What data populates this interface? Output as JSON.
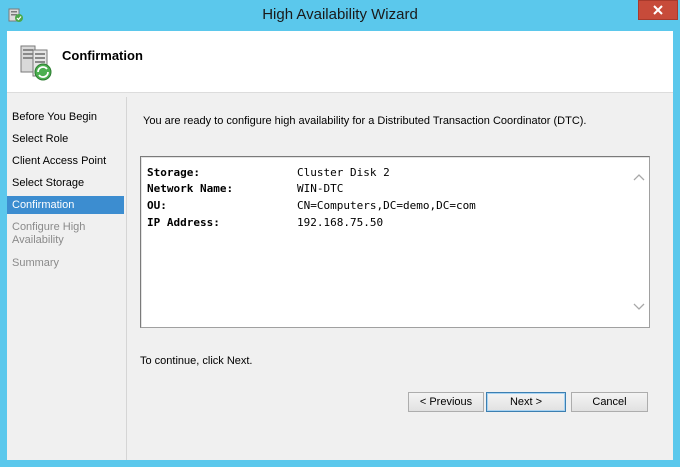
{
  "window": {
    "title": "High Availability Wizard"
  },
  "header": {
    "title": "Confirmation",
    "icon": "cluster-wizard-icon"
  },
  "nav": {
    "items": [
      {
        "label": "Before You Begin",
        "state": "normal"
      },
      {
        "label": "Select Role",
        "state": "normal"
      },
      {
        "label": "Client Access Point",
        "state": "normal"
      },
      {
        "label": "Select Storage",
        "state": "normal"
      },
      {
        "label": "Confirmation",
        "state": "active"
      },
      {
        "label": "Configure High Availability",
        "state": "disabled"
      },
      {
        "label": "Summary",
        "state": "disabled"
      }
    ]
  },
  "content": {
    "intro": "You are ready to configure high availability for a Distributed Transaction Coordinator (DTC).",
    "summary": [
      {
        "key": "Storage:",
        "value": "Cluster Disk 2"
      },
      {
        "key": "Network Name:",
        "value": "WIN-DTC"
      },
      {
        "key": "OU:",
        "value": "CN=Computers,DC=demo,DC=com"
      },
      {
        "key": "IP Address:",
        "value": "192.168.75.50"
      }
    ],
    "continue_text": "To continue, click Next."
  },
  "buttons": {
    "previous": "< Previous",
    "next": "Next >",
    "cancel": "Cancel"
  },
  "colors": {
    "titlebar": "#5bc8ec",
    "close": "#c74b3a",
    "active_nav": "#3c8dd0"
  }
}
